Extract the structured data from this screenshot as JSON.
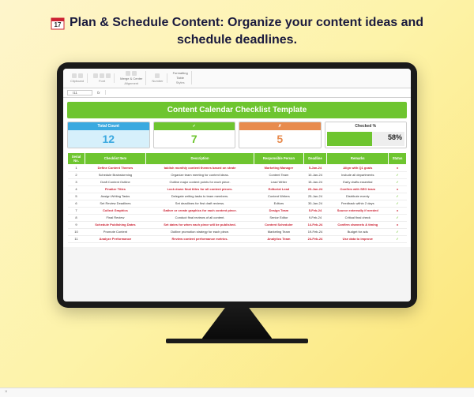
{
  "headline": "Plan & Schedule Content: Organize your content ideas and schedule deadlines.",
  "ribbon": {
    "groups": [
      "Clipboard",
      "Font",
      "Alignment",
      "Number",
      "Styles"
    ],
    "merge": "Merge & Center",
    "formatting": "Formatting",
    "table": "Table"
  },
  "cellbar": {
    "ref": "I11",
    "fx": "fx"
  },
  "banner": "Content Calendar Checklist Template",
  "cards": {
    "total": {
      "label": "Total Count",
      "value": "12"
    },
    "done": {
      "label": "✓",
      "value": "7"
    },
    "pending": {
      "label": "✗",
      "value": "5"
    },
    "checked": {
      "label": "Checked %",
      "value": "58%"
    }
  },
  "columns": [
    "Serial No.",
    "Checklist Item",
    "Description",
    "Responsible Person",
    "Deadline",
    "Remarks",
    "Status"
  ],
  "rows": [
    {
      "n": "1",
      "item": "Define Content Themes",
      "desc": "tablish monthly content themes based on strate",
      "who": "Marketing Manager",
      "due": "5-Jan-24",
      "rem": "Align with Q1 goals",
      "st": "x",
      "red": true
    },
    {
      "n": "2",
      "item": "Schedule Brainstorming",
      "desc": "Organize team meeting for content ideas.",
      "who": "Content Team",
      "due": "10-Jan-24",
      "rem": "Include all departments",
      "st": "✓",
      "red": false
    },
    {
      "n": "3",
      "item": "Draft Content Outline",
      "desc": "Outline major content points for each piece.",
      "who": "Lead Writer",
      "due": "15-Jan-24",
      "rem": "Early drafts essential",
      "st": "✓",
      "red": false
    },
    {
      "n": "4",
      "item": "Finalize Titles",
      "desc": "Lock down final titles for all content pieces.",
      "who": "Editorial Lead",
      "due": "20-Jan-24",
      "rem": "Confirm with SEO team",
      "st": "x",
      "red": true
    },
    {
      "n": "5",
      "item": "Assign Writing Tasks",
      "desc": "Delegate writing tasks to team members.",
      "who": "Content Writers",
      "due": "25-Jan-24",
      "rem": "Distribute evenly",
      "st": "✓",
      "red": false
    },
    {
      "n": "6",
      "item": "Set Review Deadlines",
      "desc": "Set deadlines for first draft reviews.",
      "who": "Editors",
      "due": "30-Jan-24",
      "rem": "Feedback within 2 days",
      "st": "✓",
      "red": false
    },
    {
      "n": "7",
      "item": "Collect Graphics",
      "desc": "Gather or create graphics for each content piece.",
      "who": "Design Team",
      "due": "5-Feb-24",
      "rem": "Source externally if needed",
      "st": "x",
      "red": true
    },
    {
      "n": "8",
      "item": "Final Review",
      "desc": "Conduct final reviews of all content.",
      "who": "Senior Editor",
      "due": "9-Feb-24",
      "rem": "Critical final check",
      "st": "✓",
      "red": false
    },
    {
      "n": "9",
      "item": "Schedule Publishing Dates",
      "desc": "Set dates for when each piece will be published.",
      "who": "Content Scheduler",
      "due": "14-Feb-24",
      "rem": "Confirm channels & timing",
      "st": "x",
      "red": true
    },
    {
      "n": "10",
      "item": "Promote Content",
      "desc": "Outline promotion strategy for each piece.",
      "who": "Marketing Team",
      "due": "19-Feb-24",
      "rem": "Budget for ads",
      "st": "✓",
      "red": false
    },
    {
      "n": "11",
      "item": "Analyze Performance",
      "desc": "Review content performance metrics.",
      "who": "Analytics Team",
      "due": "24-Feb-24",
      "rem": "Use data to improve",
      "st": "✓",
      "red": true
    }
  ]
}
